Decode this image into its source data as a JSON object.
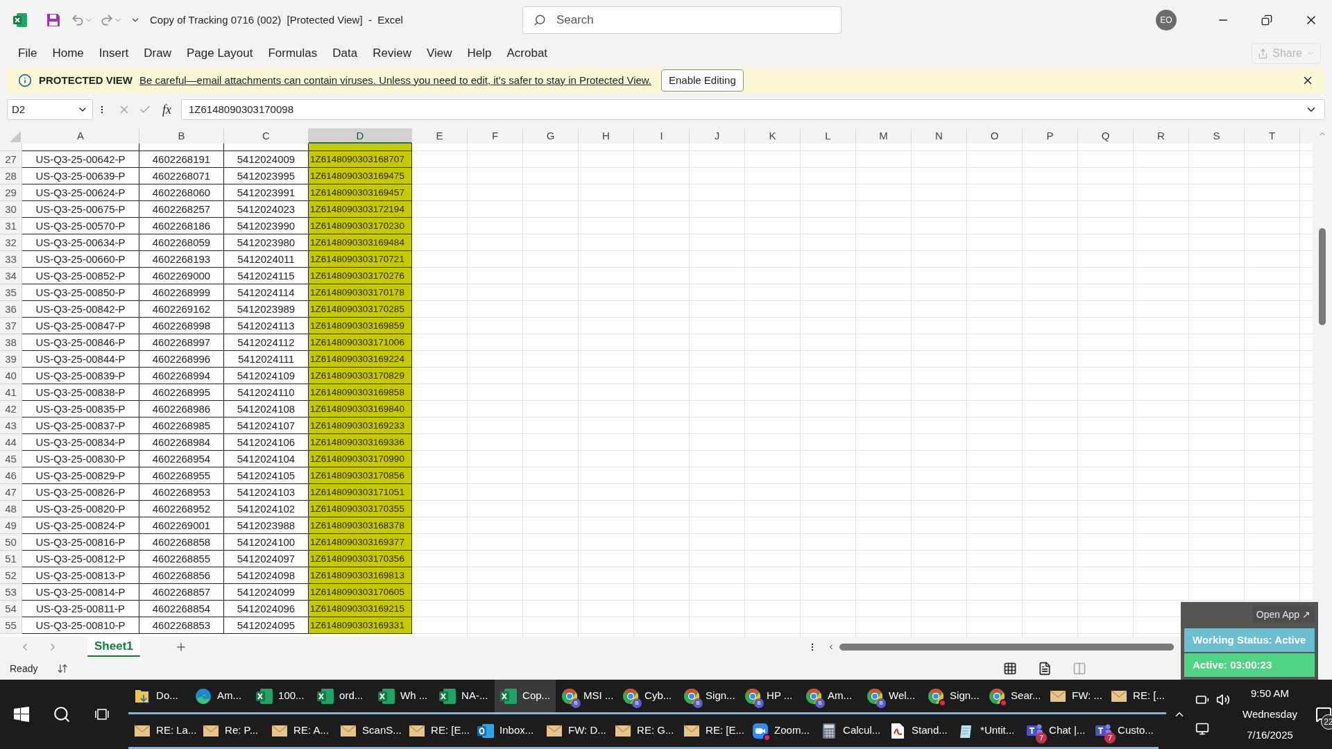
{
  "window": {
    "title": "Copy of Tracking 0716 (002)  [Protected View]  -  Excel"
  },
  "search": {
    "placeholder": "Search"
  },
  "account": {
    "initials": "EO"
  },
  "ribbon": {
    "tabs": [
      "File",
      "Home",
      "Insert",
      "Draw",
      "Page Layout",
      "Formulas",
      "Data",
      "Review",
      "View",
      "Help",
      "Acrobat"
    ],
    "share": {
      "label": "Share",
      "disabled": true
    }
  },
  "protected_view": {
    "title": "PROTECTED VIEW",
    "message": "Be careful—email attachments can contain viruses. Unless you need to edit, it's safer to stay in Protected View.",
    "button": "Enable Editing"
  },
  "formula_bar": {
    "name_box": "D2",
    "function_label": "fx",
    "value": "1Z6148090303170098"
  },
  "sheet": {
    "columns": [
      {
        "label": "A",
        "selected": false,
        "highlighted": false
      },
      {
        "label": "B",
        "selected": false,
        "highlighted": false
      },
      {
        "label": "C",
        "selected": false,
        "highlighted": false
      },
      {
        "label": "D",
        "selected": true,
        "highlighted": true
      },
      {
        "label": "E",
        "selected": false,
        "highlighted": false
      },
      {
        "label": "F",
        "selected": false,
        "highlighted": false
      },
      {
        "label": "G",
        "selected": false,
        "highlighted": false
      },
      {
        "label": "H",
        "selected": false,
        "highlighted": false
      },
      {
        "label": "I",
        "selected": false,
        "highlighted": false
      },
      {
        "label": "J",
        "selected": false,
        "highlighted": false
      },
      {
        "label": "K",
        "selected": false,
        "highlighted": false
      },
      {
        "label": "L",
        "selected": false,
        "highlighted": false
      },
      {
        "label": "M",
        "selected": false,
        "highlighted": false
      },
      {
        "label": "N",
        "selected": false,
        "highlighted": false
      },
      {
        "label": "O",
        "selected": false,
        "highlighted": false
      },
      {
        "label": "P",
        "selected": false,
        "highlighted": false
      },
      {
        "label": "Q",
        "selected": false,
        "highlighted": false
      },
      {
        "label": "R",
        "selected": false,
        "highlighted": false
      },
      {
        "label": "S",
        "selected": false,
        "highlighted": false
      },
      {
        "label": "T",
        "selected": false,
        "highlighted": false
      }
    ],
    "rows": [
      {
        "number": "27",
        "cells": [
          "US-Q3-25-00642-P",
          "4602268191",
          "5412024009",
          "1Z6148090303168707"
        ]
      },
      {
        "number": "28",
        "cells": [
          "US-Q3-25-00639-P",
          "4602268071",
          "5412023995",
          "1Z6148090303169475"
        ]
      },
      {
        "number": "29",
        "cells": [
          "US-Q3-25-00624-P",
          "4602268060",
          "5412023991",
          "1Z6148090303169457"
        ]
      },
      {
        "number": "30",
        "cells": [
          "US-Q3-25-00675-P",
          "4602268257",
          "5412024023",
          "1Z6148090303172194"
        ]
      },
      {
        "number": "31",
        "cells": [
          "US-Q3-25-00570-P",
          "4602268186",
          "5412023990",
          "1Z6148090303170230"
        ]
      },
      {
        "number": "32",
        "cells": [
          "US-Q3-25-00634-P",
          "4602268059",
          "5412023980",
          "1Z6148090303169484"
        ]
      },
      {
        "number": "33",
        "cells": [
          "US-Q3-25-00660-P",
          "4602268193",
          "5412024011",
          "1Z6148090303170721"
        ]
      },
      {
        "number": "34",
        "cells": [
          "US-Q3-25-00852-P",
          "4602269000",
          "5412024115",
          "1Z6148090303170276"
        ]
      },
      {
        "number": "35",
        "cells": [
          "US-Q3-25-00850-P",
          "4602268999",
          "5412024114",
          "1Z6148090303170178"
        ]
      },
      {
        "number": "36",
        "cells": [
          "US-Q3-25-00842-P",
          "4602269162",
          "5412023989",
          "1Z6148090303170285"
        ]
      },
      {
        "number": "37",
        "cells": [
          "US-Q3-25-00847-P",
          "4602268998",
          "5412024113",
          "1Z6148090303169859"
        ]
      },
      {
        "number": "38",
        "cells": [
          "US-Q3-25-00846-P",
          "4602268997",
          "5412024112",
          "1Z6148090303171006"
        ]
      },
      {
        "number": "39",
        "cells": [
          "US-Q3-25-00844-P",
          "4602268996",
          "5412024111",
          "1Z6148090303169224"
        ]
      },
      {
        "number": "40",
        "cells": [
          "US-Q3-25-00839-P",
          "4602268994",
          "5412024109",
          "1Z6148090303170829"
        ]
      },
      {
        "number": "41",
        "cells": [
          "US-Q3-25-00838-P",
          "4602268995",
          "5412024110",
          "1Z6148090303169858"
        ]
      },
      {
        "number": "42",
        "cells": [
          "US-Q3-25-00835-P",
          "4602268986",
          "5412024108",
          "1Z6148090303169840"
        ]
      },
      {
        "number": "43",
        "cells": [
          "US-Q3-25-00837-P",
          "4602268985",
          "5412024107",
          "1Z6148090303169233"
        ]
      },
      {
        "number": "44",
        "cells": [
          "US-Q3-25-00834-P",
          "4602268984",
          "5412024106",
          "1Z6148090303169336"
        ]
      },
      {
        "number": "45",
        "cells": [
          "US-Q3-25-00830-P",
          "4602268954",
          "5412024104",
          "1Z6148090303170990"
        ]
      },
      {
        "number": "46",
        "cells": [
          "US-Q3-25-00829-P",
          "4602268955",
          "5412024105",
          "1Z6148090303170856"
        ]
      },
      {
        "number": "47",
        "cells": [
          "US-Q3-25-00826-P",
          "4602268953",
          "5412024103",
          "1Z6148090303171051"
        ]
      },
      {
        "number": "48",
        "cells": [
          "US-Q3-25-00820-P",
          "4602268952",
          "5412024102",
          "1Z6148090303170355"
        ]
      },
      {
        "number": "49",
        "cells": [
          "US-Q3-25-00824-P",
          "4602269001",
          "5412023988",
          "1Z6148090303168378"
        ]
      },
      {
        "number": "50",
        "cells": [
          "US-Q3-25-00816-P",
          "4602268858",
          "5412024100",
          "1Z6148090303169377"
        ]
      },
      {
        "number": "51",
        "cells": [
          "US-Q3-25-00812-P",
          "4602268855",
          "5412024097",
          "1Z6148090303170356"
        ]
      },
      {
        "number": "52",
        "cells": [
          "US-Q3-25-00813-P",
          "4602268856",
          "5412024098",
          "1Z6148090303169813"
        ]
      },
      {
        "number": "53",
        "cells": [
          "US-Q3-25-00814-P",
          "4602268857",
          "5412024099",
          "1Z6148090303170605"
        ]
      },
      {
        "number": "54",
        "cells": [
          "US-Q3-25-00811-P",
          "4602268854",
          "5412024096",
          "1Z6148090303169215"
        ]
      },
      {
        "number": "55",
        "cells": [
          "US-Q3-25-00810-P",
          "4602268853",
          "5412024095",
          "1Z6148090303169331"
        ]
      }
    ]
  },
  "sheet_tabs": [
    {
      "label": "Sheet1",
      "selected": true
    }
  ],
  "status_bar": {
    "text": "Ready"
  },
  "overlay": {
    "open_app": "Open App ↗",
    "status": "Working Status: Active",
    "timer": "Active: 03:00:23"
  },
  "taskbar": {
    "upper": [
      {
        "kind": "folder",
        "label": "Do...",
        "selected": false
      },
      {
        "kind": "edge",
        "label": "Am...",
        "selected": false
      },
      {
        "kind": "excel",
        "label": "100...",
        "selected": false
      },
      {
        "kind": "excel",
        "label": "ord...",
        "selected": false
      },
      {
        "kind": "excel",
        "label": "Wh ...",
        "selected": false
      },
      {
        "kind": "excel",
        "label": "NA-...",
        "selected": false
      },
      {
        "kind": "excel",
        "label": "Cop...",
        "selected": true
      },
      {
        "kind": "chrome",
        "label": "MSI ...",
        "selected": false,
        "profile": "B"
      },
      {
        "kind": "chrome",
        "label": "Cyb...",
        "selected": false,
        "profile": "B"
      },
      {
        "kind": "chrome",
        "label": "Sign...",
        "selected": false,
        "profile": "B"
      },
      {
        "kind": "chrome",
        "label": "HP ...",
        "selected": false,
        "profile": "B"
      },
      {
        "kind": "chrome",
        "label": "Am...",
        "selected": false,
        "profile": "B"
      },
      {
        "kind": "chrome",
        "label": "Wel...",
        "selected": false,
        "profile": "B"
      },
      {
        "kind": "chrome",
        "label": "Sign...",
        "selected": false,
        "alert": true
      },
      {
        "kind": "chrome",
        "label": "Sear...",
        "selected": false,
        "alert": true
      },
      {
        "kind": "mail",
        "label": "FW: ...",
        "selected": false
      },
      {
        "kind": "mail",
        "label": "RE: [...",
        "selected": false
      }
    ],
    "lower": [
      {
        "kind": "mail",
        "label": "RE: La...",
        "selected": false
      },
      {
        "kind": "mail",
        "label": "Re: P...",
        "selected": false
      },
      {
        "kind": "mail",
        "label": "RE: A...",
        "selected": false
      },
      {
        "kind": "mail",
        "label": "ScanS...",
        "selected": false
      },
      {
        "kind": "mail",
        "label": "RE: [E...",
        "selected": false
      },
      {
        "kind": "outlook",
        "label": "Inbox...",
        "selected": false
      },
      {
        "kind": "mail",
        "label": "FW: D...",
        "selected": false
      },
      {
        "kind": "mail",
        "label": "RE: G...",
        "selected": false
      },
      {
        "kind": "mail",
        "label": "RE: [E...",
        "selected": false
      },
      {
        "kind": "zoom",
        "label": "Zoom...",
        "selected": false,
        "alert": true
      },
      {
        "kind": "calculator",
        "label": "Calcul...",
        "selected": false
      },
      {
        "kind": "pdf",
        "label": "Stand...",
        "selected": false
      },
      {
        "kind": "notepad",
        "label": "*Untit...",
        "selected": false
      },
      {
        "kind": "teams",
        "label": "Chat |...",
        "selected": false,
        "badge": "7"
      },
      {
        "kind": "teams",
        "label": "Custo...",
        "selected": false,
        "badge": "7"
      }
    ],
    "clock": {
      "time": "9:50 AM",
      "day": "Wednesday",
      "date": "7/16/2025"
    },
    "notifications": "22"
  }
}
